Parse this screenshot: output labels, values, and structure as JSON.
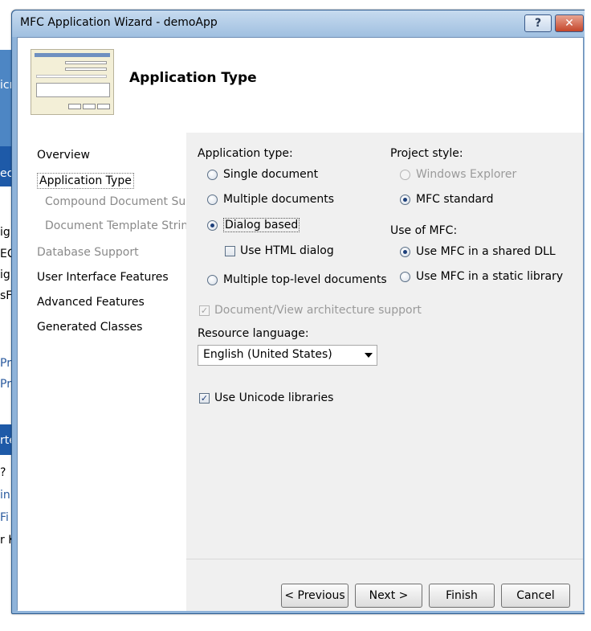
{
  "window": {
    "title": "MFC Application Wizard - demoApp",
    "help_glyph": "?",
    "close_glyph": "✕"
  },
  "header": {
    "title": "Application Type"
  },
  "nav": {
    "items": [
      {
        "label": "Overview",
        "state": "normal"
      },
      {
        "label": "Application Type",
        "state": "selected"
      },
      {
        "label": "Compound Document Support",
        "state": "disabled"
      },
      {
        "label": "Document Template Strings",
        "state": "disabled"
      },
      {
        "label": "Database Support",
        "state": "disabled"
      },
      {
        "label": "User Interface Features",
        "state": "normal"
      },
      {
        "label": "Advanced Features",
        "state": "normal"
      },
      {
        "label": "Generated Classes",
        "state": "normal"
      }
    ]
  },
  "app_type": {
    "label": "Application type:",
    "single_document": "Single document",
    "multiple_documents": "Multiple documents",
    "dialog_based": "Dialog based",
    "use_html_dialog": "Use HTML dialog",
    "multiple_top_level": "Multiple top-level documents",
    "doc_view_support": "Document/View architecture support",
    "selected": "Dialog based"
  },
  "project_style": {
    "label": "Project style:",
    "windows_explorer": "Windows Explorer",
    "mfc_standard": "MFC standard",
    "selected": "MFC standard"
  },
  "use_of_mfc": {
    "label": "Use of MFC:",
    "shared_dll": "Use MFC in a shared DLL",
    "static_library": "Use MFC in a static library",
    "selected": "Use MFC in a shared DLL"
  },
  "resource_language": {
    "label": "Resource language:",
    "value": "English (United States)"
  },
  "unicode": {
    "label": "Use Unicode libraries",
    "checked": true
  },
  "checkmark": "✓",
  "buttons": {
    "previous": "< Previous",
    "next": "Next >",
    "finish": "Finish",
    "cancel": "Cancel"
  },
  "background_fragments": [
    "icr",
    "ec",
    "igl",
    "EC",
    "igl",
    "sFo",
    "Pr",
    "Pr",
    "rte",
    "?",
    "in",
    "Fi",
    "r K"
  ]
}
